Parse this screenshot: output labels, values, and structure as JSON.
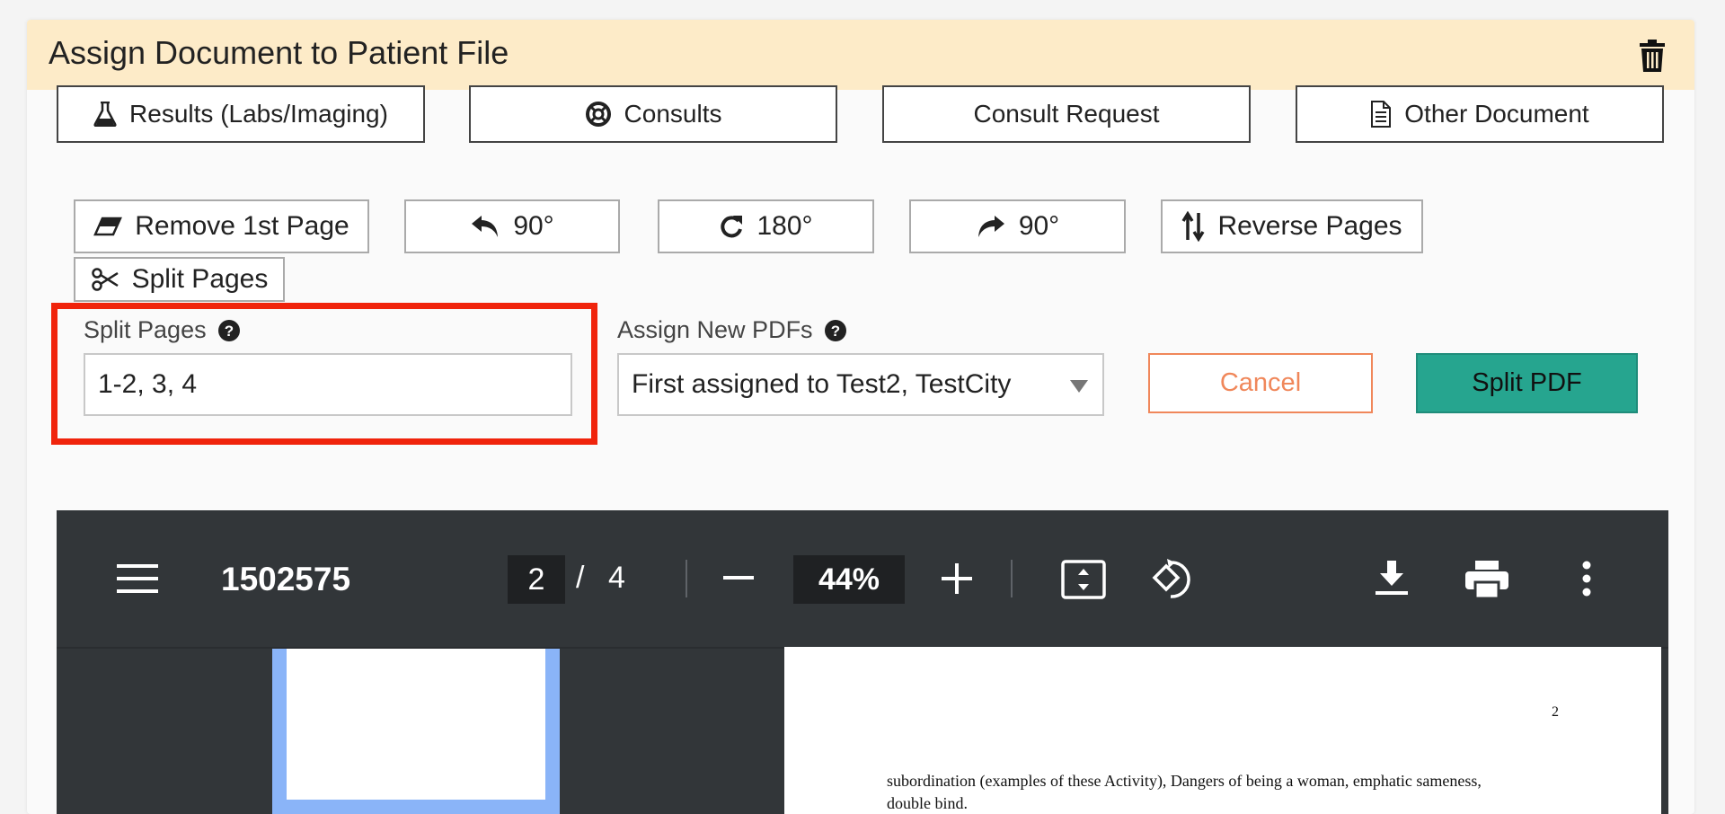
{
  "header": {
    "title": "Assign Document to Patient File"
  },
  "doc_types": [
    {
      "label": "Results (Labs/Imaging)",
      "icon": "flask-icon"
    },
    {
      "label": "Consults",
      "icon": "lifebuoy-icon"
    },
    {
      "label": "Consult Request",
      "icon": ""
    },
    {
      "label": "Other Document",
      "icon": "file-text-icon"
    }
  ],
  "tools": {
    "remove_first": "Remove 1st Page",
    "rotate_left": "90°",
    "rotate_180": "180°",
    "rotate_right": "90°",
    "reverse": "Reverse Pages",
    "split": "Split Pages"
  },
  "split_form": {
    "pages_label": "Split Pages",
    "pages_value": "1-2, 3, 4",
    "assign_label": "Assign New PDFs",
    "assign_selected": "First assigned to Test2, TestCity",
    "cancel_label": "Cancel",
    "split_label": "Split PDF"
  },
  "viewer": {
    "file_name": "1502575",
    "current_page": "2",
    "page_sep": "/",
    "total_pages": "4",
    "zoom": "44%",
    "page_number_text": "2",
    "text_lines": [
      "subordination (examples of these Activity), Dangers of being a woman, emphatic sameness,",
      "double bind."
    ]
  },
  "colors": {
    "header_bg": "#fdebc8",
    "highlight": "#f0240c",
    "cancel": "#f0875a",
    "split_pdf": "#26a58f",
    "viewer_bg": "#323639",
    "thumb_selected": "#8ab4f8"
  }
}
